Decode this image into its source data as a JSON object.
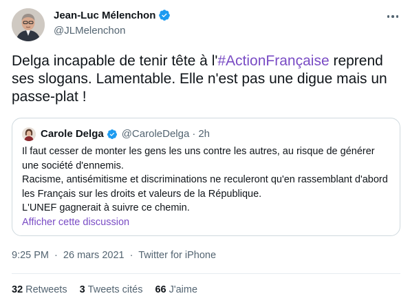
{
  "author": {
    "name": "Jean-Luc Mélenchon",
    "handle": "@JLMelenchon"
  },
  "tweet": {
    "text_before": "Delga incapable de tenir tête à l'",
    "hashtag": "#ActionFrançaise",
    "text_after": " reprend ses slogans. Lamentable. Elle n'est pas une digue mais un passe-plat !"
  },
  "quote": {
    "name": "Carole Delga",
    "handle": "@CaroleDelga",
    "separator": "·",
    "time": "2h",
    "lines": [
      "Il faut cesser de monter les gens les uns contre les autres, au risque de générer une société d'ennemis.",
      "Racisme, antisémitisme et discriminations ne reculeront qu'en rassemblant d'abord les Français sur les droits et valeurs de la République.",
      "L'UNEF gagnerait à suivre ce chemin."
    ],
    "link_label": "Afficher cette discussion"
  },
  "meta": {
    "time": "9:25 PM",
    "separator": "·",
    "date": "26 mars 2021",
    "source": "Twitter for iPhone"
  },
  "stats": [
    {
      "count": "32",
      "label": "Retweets"
    },
    {
      "count": "3",
      "label": "Tweets cités"
    },
    {
      "count": "66",
      "label": "J'aime"
    }
  ],
  "icons": {
    "verified": "verified-badge-icon",
    "more": "more-options-icon"
  },
  "colors": {
    "link": "#794bc4",
    "verified": "#1d9bf0",
    "secondary_text": "#536471",
    "primary_text": "#0f1419",
    "border": "#cfd9de"
  }
}
